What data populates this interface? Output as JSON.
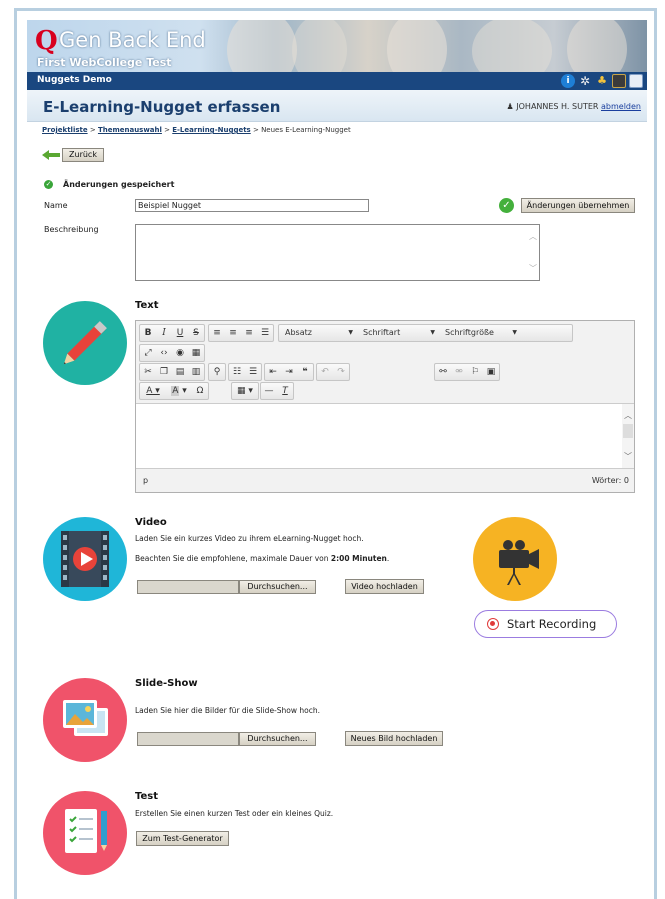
{
  "header": {
    "logo_letter": "Q",
    "logo_title": "Gen Back End",
    "subtitle": "First WebCollege Test",
    "nav_label": "Nuggets Demo"
  },
  "title_bar": {
    "page_title": "E-Learning-Nugget erfassen",
    "user_name": "JOHANNES H. SUTER",
    "logout_label": "abmelden"
  },
  "breadcrumb": {
    "items": [
      "Projektliste",
      "Themenauswahl",
      "E-Learning-Nuggets"
    ],
    "sep": " > ",
    "current": "Neues E-Learning-Nugget"
  },
  "back_label": "Zurück",
  "status_message": "Änderungen gespeichert",
  "form": {
    "name_label": "Name",
    "name_value": "Beispiel Nugget",
    "apply_label": "Änderungen übernehmen",
    "description_label": "Beschreibung"
  },
  "text_section": {
    "title": "Text",
    "format_dropdown": "Absatz",
    "font_dropdown": "Schriftart",
    "size_dropdown": "Schriftgröße",
    "path_label": "p",
    "word_count": "Wörter: 0"
  },
  "video_section": {
    "title": "Video",
    "text1": "Laden Sie ein kurzes Video zu ihrem eLearning-Nugget hoch.",
    "text2_prefix": "Beachten Sie die empfohlene, maximale Dauer von ",
    "text2_bold": "2:00 Minuten",
    "text2_suffix": ".",
    "browse_label": "Durchsuchen...",
    "upload_label": "Video hochladen",
    "record_label": "Start Recording"
  },
  "slideshow_section": {
    "title": "Slide-Show",
    "text": "Laden Sie hier die Bilder für die Slide-Show hoch.",
    "browse_label": "Durchsuchen...",
    "upload_label": "Neues Bild hochladen"
  },
  "test_section": {
    "title": "Test",
    "text": "Erstellen Sie einen kurzen Test oder ein kleines Quiz.",
    "button_label": "Zum Test-Generator"
  },
  "colors": {
    "nav_blue": "#1a4780",
    "title_blue": "#1b3f6e",
    "logo_red": "#d8001e",
    "teal": "#20b2a3",
    "cyan": "#1fb6d8",
    "orange": "#f6b323",
    "coral": "#f0536a"
  }
}
